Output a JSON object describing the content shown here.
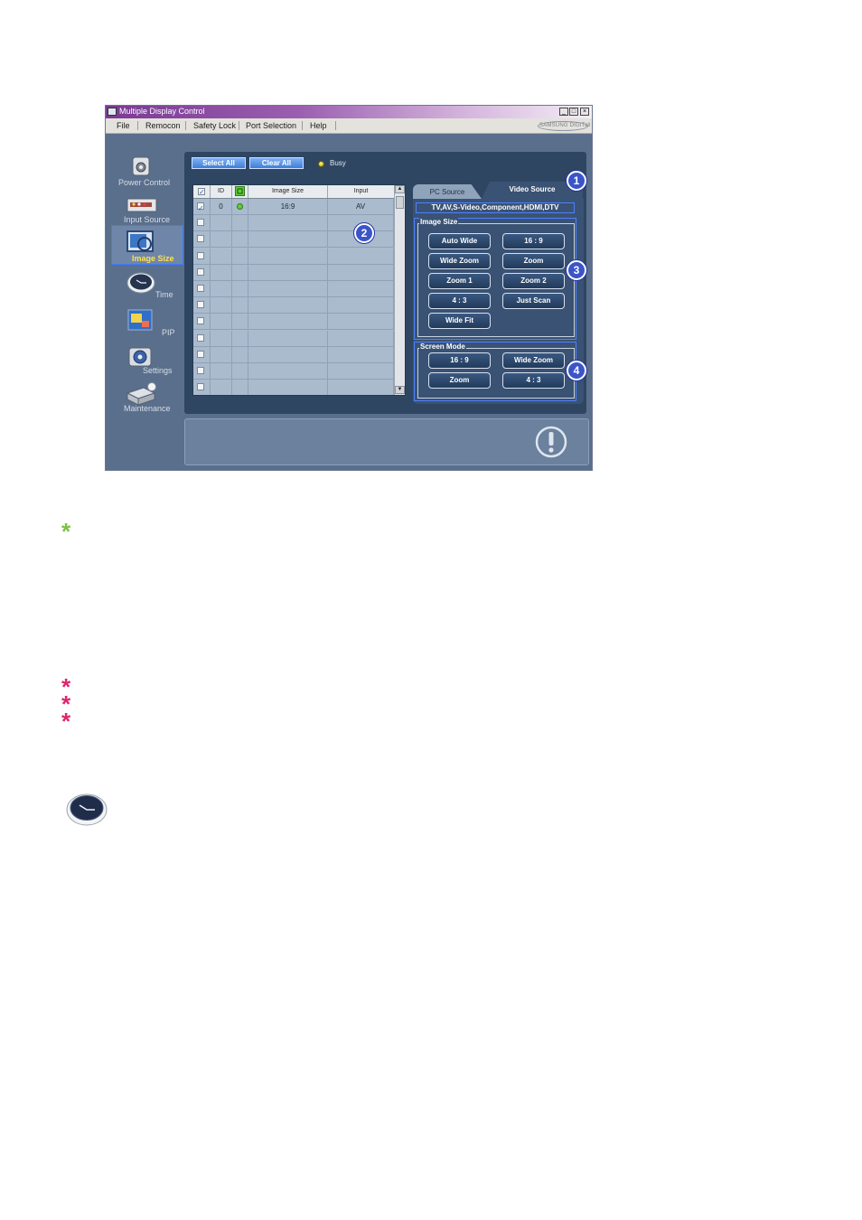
{
  "window": {
    "title": "Multiple Display Control",
    "controls": {
      "minimize": "_",
      "maximize": "□",
      "close": "×"
    }
  },
  "menu": {
    "items": [
      "File",
      "Remocon",
      "Safety Lock",
      "Port Selection",
      "Help"
    ],
    "brand": "SAMSUNG DIGITall"
  },
  "nav": {
    "items": [
      {
        "label": "Power Control",
        "icon": "power-control-icon"
      },
      {
        "label": "Input Source",
        "icon": "input-source-icon"
      },
      {
        "label": "Image Size",
        "icon": "image-size-icon",
        "selected": true
      },
      {
        "label": "Time",
        "icon": "time-icon"
      },
      {
        "label": "PIP",
        "icon": "pip-icon"
      },
      {
        "label": "Settings",
        "icon": "settings-icon"
      },
      {
        "label": "Maintenance",
        "icon": "maintenance-icon"
      }
    ]
  },
  "toolbar": {
    "select_all": "Select All",
    "clear_all": "Clear All",
    "busy_label": "Busy"
  },
  "table": {
    "headers": {
      "id": "ID",
      "image_size": "Image Size",
      "input": "Input"
    },
    "rows": [
      {
        "id": "0",
        "image_size": "16:9",
        "input": "AV",
        "checked": true,
        "status": "on"
      }
    ],
    "empty_rows": 11
  },
  "tabs": {
    "pc_source": "PC Source",
    "video_source": "Video Source",
    "active": "video_source"
  },
  "video_panel": {
    "sources": "TV,AV,S-Video,Component,HDMI,DTV",
    "image_size": {
      "title": "Image Size",
      "options": [
        "Auto Wide",
        "16 : 9",
        "Wide Zoom",
        "Zoom",
        "Zoom 1",
        "Zoom 2",
        "4 : 3",
        "Just Scan",
        "Wide Fit"
      ]
    },
    "screen_mode": {
      "title": "Screen Mode",
      "options": [
        "16 : 9",
        "Wide Zoom",
        "Zoom",
        "4 : 3"
      ]
    }
  },
  "callouts": [
    "1",
    "2",
    "3",
    "4"
  ],
  "page_markers": {
    "green_star": "*",
    "red_stars": [
      "*",
      "*",
      "*"
    ]
  },
  "colors": {
    "accent_blue": "#3b55c9",
    "selection_border": "#3d7bff",
    "busy_indicator": "#d6c800",
    "status_on": "#5fcf3a",
    "green_star": "#7dc242",
    "red_star": "#e0256b"
  }
}
